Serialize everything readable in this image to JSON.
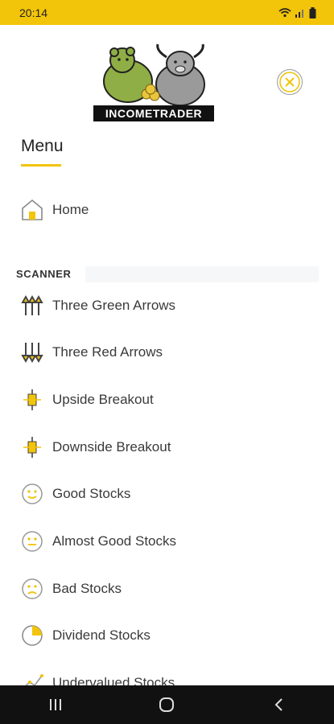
{
  "status_bar": {
    "time": "20:14",
    "icons": [
      "wifi-icon",
      "signal-icon",
      "battery-icon"
    ]
  },
  "brand": {
    "logo_text": "INCOMETRADER"
  },
  "menu": {
    "title": "Menu"
  },
  "home": {
    "label": "Home",
    "icon": "home-icon"
  },
  "scanner": {
    "title": "SCANNER",
    "items": [
      {
        "label": "Three Green Arrows",
        "icon": "three-up-arrows-icon"
      },
      {
        "label": "Three Red Arrows",
        "icon": "three-down-arrows-icon"
      },
      {
        "label": "Upside Breakout",
        "icon": "candlestick-up-icon"
      },
      {
        "label": "Downside Breakout",
        "icon": "candlestick-down-icon"
      },
      {
        "label": "Good Stocks",
        "icon": "smile-face-icon"
      },
      {
        "label": "Almost Good Stocks",
        "icon": "neutral-face-icon"
      },
      {
        "label": "Bad Stocks",
        "icon": "sad-face-icon"
      },
      {
        "label": "Dividend Stocks",
        "icon": "pie-chart-icon"
      },
      {
        "label": "Undervalued Stocks",
        "icon": "trend-line-icon"
      }
    ]
  },
  "nav": [
    "recent-apps-icon",
    "home-circle-icon",
    "back-icon"
  ],
  "colors": {
    "accent": "#f2c40a",
    "nav_bg": "#111111",
    "text": "#3a3a3a"
  }
}
